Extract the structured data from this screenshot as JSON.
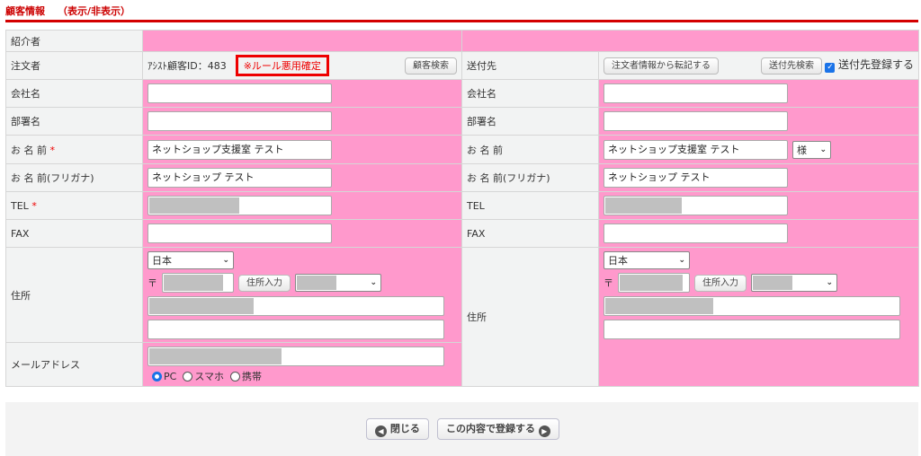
{
  "header": {
    "title": "顧客情報",
    "toggle": "（表示/非表示）"
  },
  "left": {
    "referrer_label": "紹介者",
    "orderer_label": "注文者",
    "assist_id": "ｱｼｽﾄ顧客ID：483",
    "rule_notice": "※ルール悪用確定",
    "customer_search": "顧客検索",
    "company_label": "会社名",
    "dept_label": "部署名",
    "name_label": "お 名 前",
    "required": "*",
    "name_value": "ネットショップ支援室 テスト",
    "kana_label": "お 名 前(フリガナ)",
    "kana_value": "ネットショップ テスト",
    "tel_label": "TEL",
    "fax_label": "FAX",
    "address_label": "住所",
    "country": "日本",
    "postal_mark": "〒",
    "address_input_btn": "住所入力",
    "email_label": "メールアドレス",
    "radio": [
      "PC",
      "スマホ",
      "携帯"
    ]
  },
  "right": {
    "dest_label": "送付先",
    "copy_btn": "注文者情報から転記する",
    "dest_search": "送付先検索",
    "register_label": "送付先登録する",
    "company_label": "会社名",
    "dept_label": "部署名",
    "name_label": "お 名 前",
    "name_value": "ネットショップ支援室 テスト",
    "honorific": "様",
    "kana_label": "お 名 前(フリガナ)",
    "kana_value": "ネットショップ テスト",
    "tel_label": "TEL",
    "fax_label": "FAX",
    "address_label": "住所",
    "country": "日本",
    "postal_mark": "〒",
    "address_input_btn": "住所入力"
  },
  "footer": {
    "close": "閉じる",
    "submit": "この内容で登録する"
  }
}
